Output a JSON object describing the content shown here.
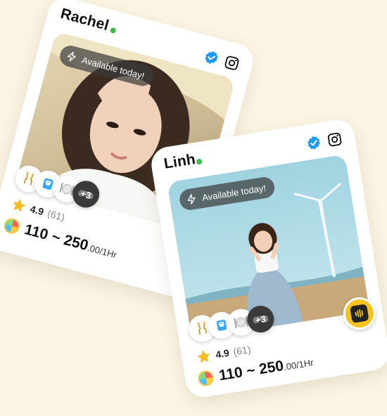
{
  "cards": [
    {
      "name": "Rachel",
      "availability": "Available today!",
      "rating": "4.9",
      "reviews": "(61)",
      "price_range": "110 ~ 250",
      "price_suffix": ".00/1Hr",
      "extra_tags": "+3",
      "online": true,
      "verified": true
    },
    {
      "name": "Linh",
      "availability": "Available today!",
      "rating": "4.9",
      "reviews": "(61)",
      "price_range": "110 ~ 250",
      "price_suffix": ".00/1Hr",
      "extra_tags": "+3",
      "online": true,
      "verified": true
    }
  ],
  "tag_icons": [
    "champagne-icon",
    "bowling-icon",
    "dining-icon",
    "gamepad-icon"
  ],
  "colors": {
    "background": "#fbf5e4",
    "online": "#3fb950",
    "verified": "#1d9bf0",
    "voice_button": "#f6c21b",
    "star": "#f5b921"
  }
}
